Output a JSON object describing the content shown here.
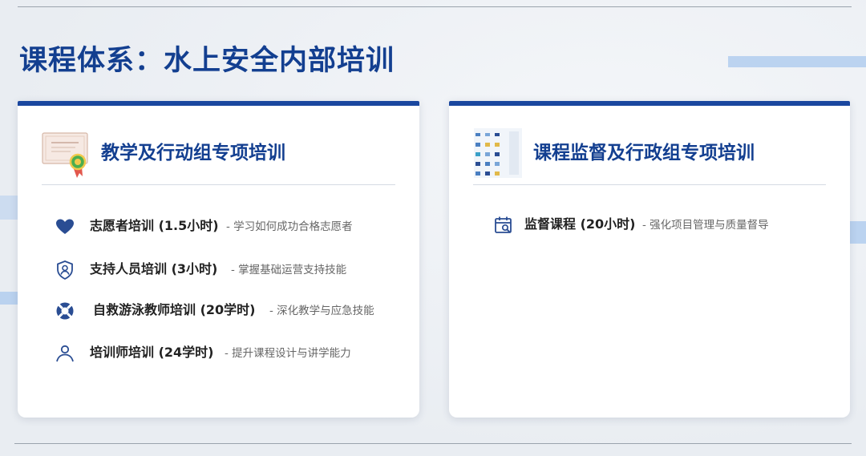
{
  "page": {
    "title": "课程体系：水上安全内部培训"
  },
  "theme": {
    "primary": "#133f90",
    "accent_bar": "#1a479f",
    "deco_blue": "#a9c8ee"
  },
  "left_card": {
    "title": "教学及行动组专项培训",
    "icon": "certificate-icon",
    "items": [
      {
        "icon": "heart-icon",
        "name": "志愿者培训 (1.5小时)",
        "desc": "- 学习如何成功合格志愿者"
      },
      {
        "icon": "shield-user-icon",
        "name": "支持人员培训 (3小时)",
        "desc": "- 掌握基础运营支持技能"
      },
      {
        "icon": "lifebuoy-icon",
        "name": "自救游泳教师培训 (20学时)",
        "desc": "- 深化教学与应急技能"
      },
      {
        "icon": "person-icon",
        "name": "培训师培训 (24学时)",
        "desc": "- 提升课程设计与讲学能力"
      }
    ]
  },
  "right_card": {
    "title": "课程监督及行政组专项培训",
    "icon": "icon-grid-icon",
    "items": [
      {
        "icon": "calendar-search-icon",
        "name": "监督课程 (20小时)",
        "desc": "- 强化项目管理与质量督导"
      }
    ]
  }
}
